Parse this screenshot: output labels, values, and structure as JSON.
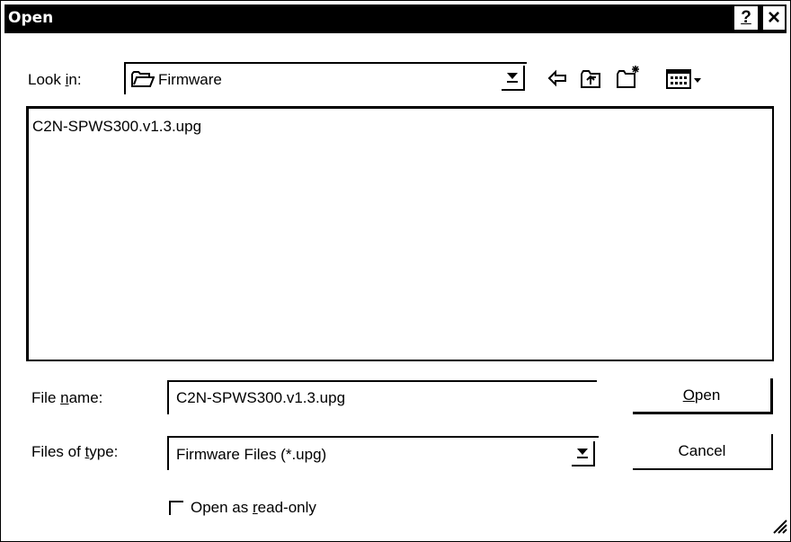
{
  "window": {
    "title": "Open",
    "help_button": "?",
    "close_button": "×"
  },
  "look_in": {
    "label_pre": "Look ",
    "label_hotkey": "i",
    "label_post": "n:",
    "value": "Firmware",
    "icon": "folder-icon"
  },
  "toolbar": [
    {
      "name": "back-icon"
    },
    {
      "name": "up-folder-icon"
    },
    {
      "name": "new-folder-icon"
    },
    {
      "name": "view-menu-icon"
    }
  ],
  "files": [
    {
      "name": "C2N-SPWS300.v1.3.upg"
    }
  ],
  "file_name": {
    "label_pre": "File ",
    "label_hotkey": "n",
    "label_post": "ame:",
    "value": "C2N-SPWS300.v1.3.upg"
  },
  "file_type": {
    "label_pre": "Files of ",
    "label_hotkey": "t",
    "label_post": "ype:",
    "value": "Firmware Files (*.upg)"
  },
  "buttons": {
    "open_hotkey": "O",
    "open_rest": "pen",
    "cancel": "Cancel"
  },
  "readonly": {
    "label_pre": "Open as ",
    "label_hotkey": "r",
    "label_post": "ead-only",
    "checked": false
  }
}
